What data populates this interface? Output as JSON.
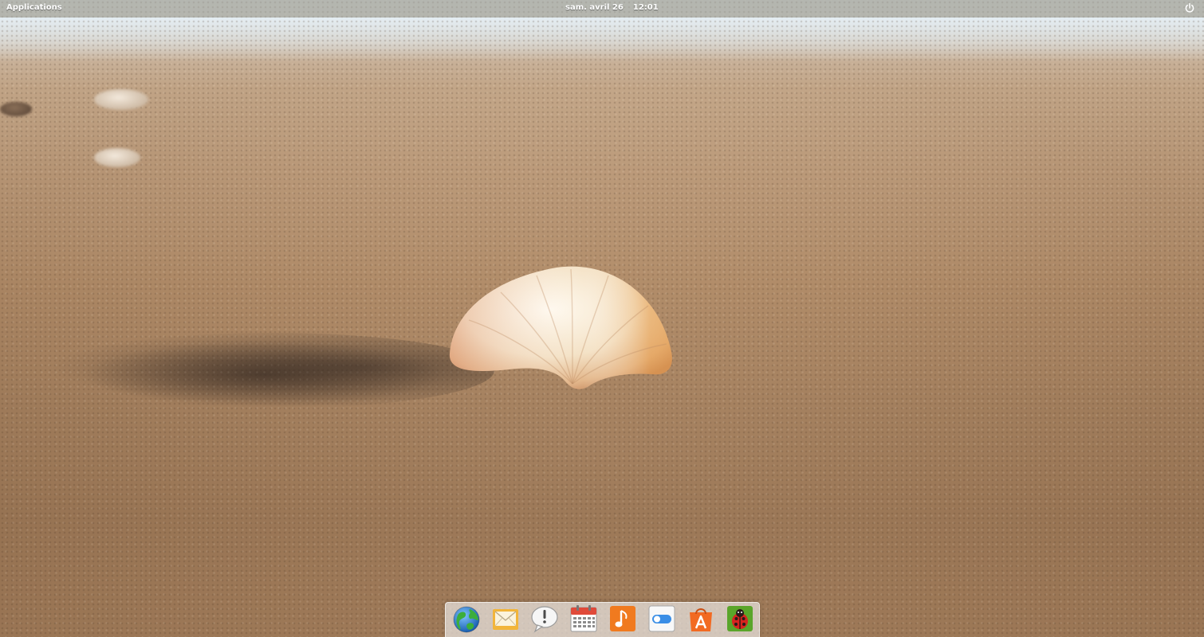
{
  "top_panel": {
    "applications_label": "Applications",
    "date": "sam. avril 26",
    "time": "12:01",
    "power_icon": "power-icon"
  },
  "dock": {
    "items": [
      {
        "icon": "web-browser-icon",
        "color": "#2a7fd0"
      },
      {
        "icon": "mail-icon",
        "color": "#f2b53a"
      },
      {
        "icon": "messaging-icon",
        "color": "#e8e8e8"
      },
      {
        "icon": "calendar-icon",
        "color": "#e04a3a"
      },
      {
        "icon": "music-icon",
        "color": "#f07a1f"
      },
      {
        "icon": "settings-switch-icon",
        "color": "#3a8ee6"
      },
      {
        "icon": "app-center-icon",
        "color": "#f26a22"
      },
      {
        "icon": "bug-reporter-icon",
        "color": "#5aa52a"
      }
    ]
  }
}
